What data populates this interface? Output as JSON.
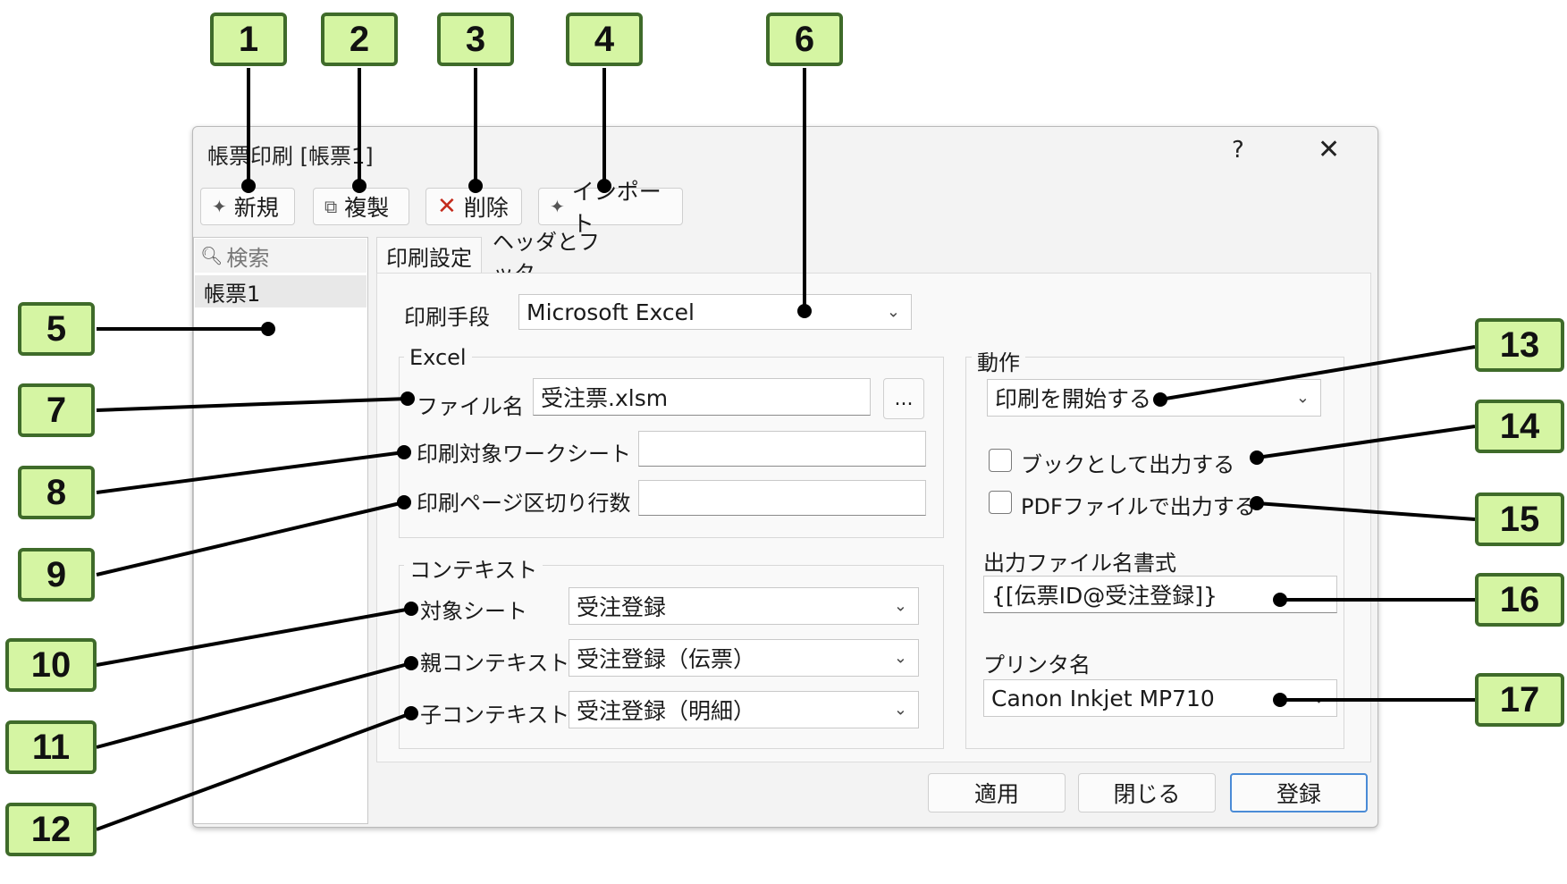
{
  "window": {
    "title": "帳票印刷 [帳票1]",
    "help_glyph": "?",
    "close_glyph": "✕"
  },
  "toolbar": {
    "new_label": "新規",
    "copy_label": "複製",
    "delete_label": "削除",
    "import_label": "インポート"
  },
  "left_panel": {
    "search_placeholder": "検索",
    "items": [
      "帳票1"
    ]
  },
  "tabs": [
    "印刷設定",
    "ヘッダとフッタ"
  ],
  "print_method": {
    "label": "印刷手段",
    "value": "Microsoft Excel"
  },
  "excel_group": {
    "title": "Excel",
    "file_label": "ファイル名",
    "file_value": "受注票.xlsm",
    "browse_label": "...",
    "sheet_label": "印刷対象ワークシート",
    "sheet_value": "",
    "page_break_label": "印刷ページ区切り行数",
    "page_break_value": ""
  },
  "context_group": {
    "title": "コンテキスト",
    "target_label": "対象シート",
    "target_value": "受注登録",
    "parent_label": "親コンテキスト",
    "parent_value": "受注登録（伝票）",
    "child_label": "子コンテキスト",
    "child_value": "受注登録（明細）"
  },
  "action_group": {
    "title": "動作",
    "action_value": "印刷を開始する",
    "book_label": "ブックとして出力する",
    "book_checked": false,
    "pdf_label": "PDFファイルで出力する",
    "pdf_checked": false,
    "filename_format_label": "出力ファイル名書式",
    "filename_format_value": "{[伝票ID@受注登録]}",
    "printer_label": "プリンタ名",
    "printer_value": "Canon Inkjet MP710"
  },
  "buttons": {
    "apply_label": "適用",
    "close_label": "閉じる",
    "register_label": "登録"
  },
  "callouts": [
    "1",
    "2",
    "3",
    "4",
    "5",
    "6",
    "7",
    "8",
    "9",
    "10",
    "11",
    "12",
    "13",
    "14",
    "15",
    "16",
    "17"
  ],
  "colors": {
    "callout_fill": "#d5f5a3",
    "callout_border": "#3f6b2a",
    "delete_icon": "#c42b1c",
    "primary_border": "#4a8bd6"
  }
}
